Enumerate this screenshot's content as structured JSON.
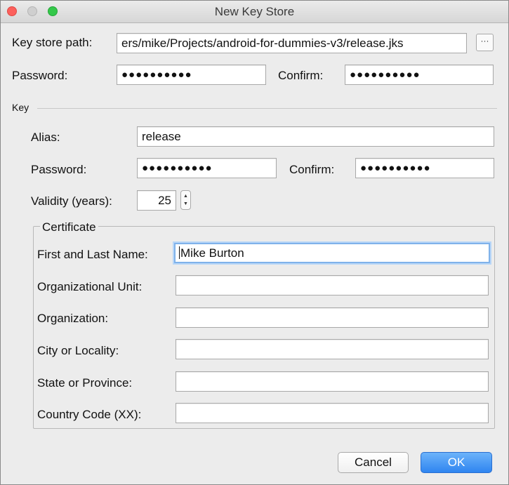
{
  "window": {
    "title": "New Key Store"
  },
  "keystore": {
    "path_label": "Key store path:",
    "path_value": "ers/mike/Projects/android-for-dummies-v3/release.jks",
    "browse_label": "···",
    "password_label": "Password:",
    "password_value": "●●●●●●●●●●",
    "confirm_label": "Confirm:",
    "confirm_value": "●●●●●●●●●●"
  },
  "key": {
    "section_label": "Key",
    "alias_label": "Alias:",
    "alias_value": "release",
    "password_label": "Password:",
    "password_value": "●●●●●●●●●●",
    "confirm_label": "Confirm:",
    "confirm_value": "●●●●●●●●●●",
    "validity_label": "Validity (years):",
    "validity_value": "25",
    "spin_up": "▲",
    "spin_down": "▼"
  },
  "certificate": {
    "group_label": "Certificate",
    "first_last_label": "First and Last Name:",
    "first_last_value": "Mike Burton",
    "org_unit_label": "Organizational Unit:",
    "org_unit_value": "",
    "organization_label": "Organization:",
    "organization_value": "",
    "city_label": "City or Locality:",
    "city_value": "",
    "state_label": "State or Province:",
    "state_value": "",
    "country_label": "Country Code (XX):",
    "country_value": ""
  },
  "buttons": {
    "cancel": "Cancel",
    "ok": "OK"
  },
  "colors": {
    "ok_button": "#2f85f0",
    "focus_ring": "#7fb2ea",
    "close": "#fc605c",
    "maximize": "#34c84a"
  }
}
